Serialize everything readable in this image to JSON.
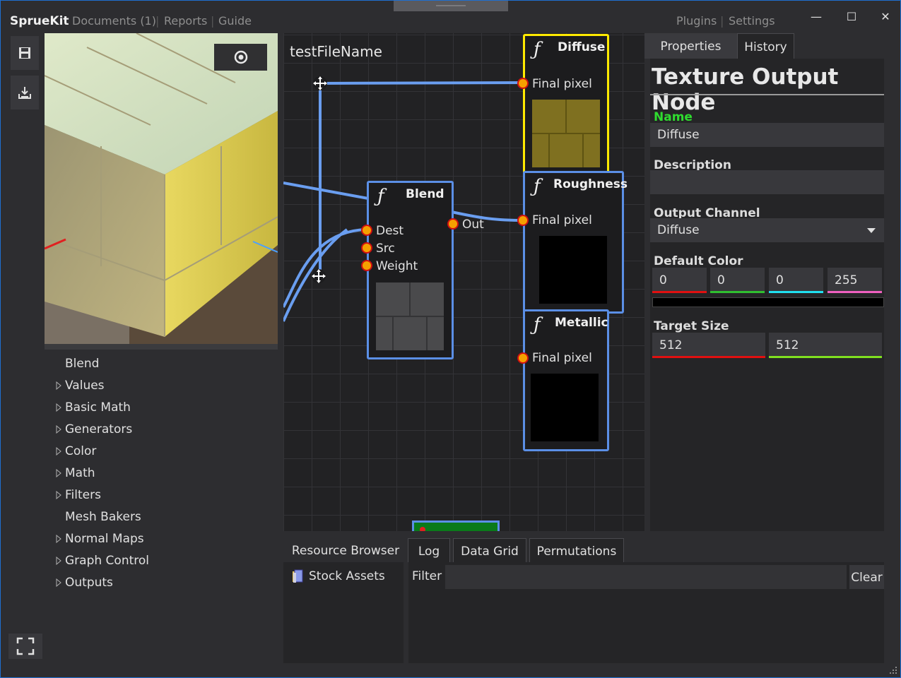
{
  "app": {
    "name": "SprueKit",
    "nav_left": [
      "Documents (1)",
      "Reports",
      "Guide"
    ],
    "nav_right": [
      "Plugins",
      "Settings"
    ],
    "window_controls": {
      "minimize": "—",
      "maximize": "☐",
      "close": "✕"
    }
  },
  "toolbar": {
    "icons": [
      "save-icon",
      "export-icon"
    ]
  },
  "preview": {
    "toggle_icon": "eye-icon"
  },
  "tree": {
    "items": [
      {
        "label": "Blend",
        "expandable": false
      },
      {
        "label": "Values",
        "expandable": true
      },
      {
        "label": "Basic Math",
        "expandable": true
      },
      {
        "label": "Generators",
        "expandable": true
      },
      {
        "label": "Color",
        "expandable": true
      },
      {
        "label": "Math",
        "expandable": true
      },
      {
        "label": "Filters",
        "expandable": true
      },
      {
        "label": "Mesh Bakers",
        "expandable": false
      },
      {
        "label": "Normal Maps",
        "expandable": true
      },
      {
        "label": "Graph Control",
        "expandable": true
      },
      {
        "label": "Outputs",
        "expandable": true
      }
    ]
  },
  "graph": {
    "file_name": "testFileName",
    "nodes": {
      "diffuse": {
        "title": "Diffuse",
        "port": "Final pixel"
      },
      "roughness": {
        "title": "Roughness",
        "port": "Final pixel"
      },
      "metallic": {
        "title": "Metallic",
        "port": "Final pixel"
      },
      "blend": {
        "title": "Blend",
        "inputs": [
          "Dest",
          "Src",
          "Weight"
        ],
        "output": "Out"
      }
    },
    "function_glyph": "ƒ"
  },
  "properties": {
    "tabs": [
      "Properties",
      "History"
    ],
    "title": "Texture Output Node",
    "name_label": "Name",
    "name_value": "Diffuse",
    "description_label": "Description",
    "description_value": "",
    "output_channel_label": "Output Channel",
    "output_channel_value": "Diffuse",
    "default_color_label": "Default Color",
    "default_color": [
      "0",
      "0",
      "0",
      "255"
    ],
    "target_size_label": "Target Size",
    "target_size": [
      "512",
      "512"
    ],
    "colors": {
      "r": "#e01010",
      "g": "#30c030",
      "b": "#20e0f0",
      "a": "#f060c0",
      "y": "#80e020"
    }
  },
  "bottom": {
    "tabs": [
      "Resource Browser",
      "Log",
      "Data Grid",
      "Permutations"
    ],
    "resource_item": "Stock Assets",
    "filter_label": "Filter",
    "filter_value": "",
    "clear_label": "Clear"
  }
}
